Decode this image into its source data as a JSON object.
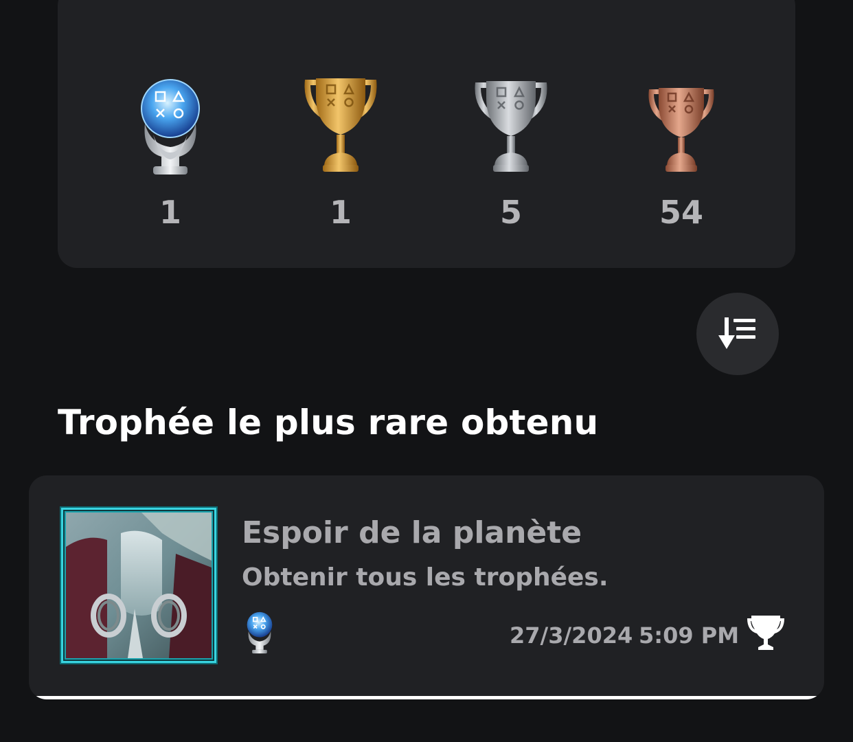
{
  "summary": {
    "trophies": [
      {
        "type": "platinum",
        "icon": "platinum-trophy-icon",
        "count": "1"
      },
      {
        "type": "gold",
        "icon": "gold-trophy-icon",
        "count": "1"
      },
      {
        "type": "silver",
        "icon": "silver-trophy-icon",
        "count": "5"
      },
      {
        "type": "bronze",
        "icon": "bronze-trophy-icon",
        "count": "54"
      }
    ]
  },
  "sort_button": {
    "icon": "sort-descending-icon"
  },
  "rarest": {
    "section_title": "Trophée le plus rare obtenu",
    "name": "Espoir de la planète",
    "description": "Obtenir tous les trophées.",
    "grade_icon": "platinum-trophy-icon",
    "date": "27/3/2024",
    "time": "5:09 PM",
    "status_icon": "trophy-icon"
  },
  "colors": {
    "background": "#121315",
    "card": "#202124",
    "muted_text": "#a9a9ad",
    "count_text": "#b5b5b8"
  }
}
